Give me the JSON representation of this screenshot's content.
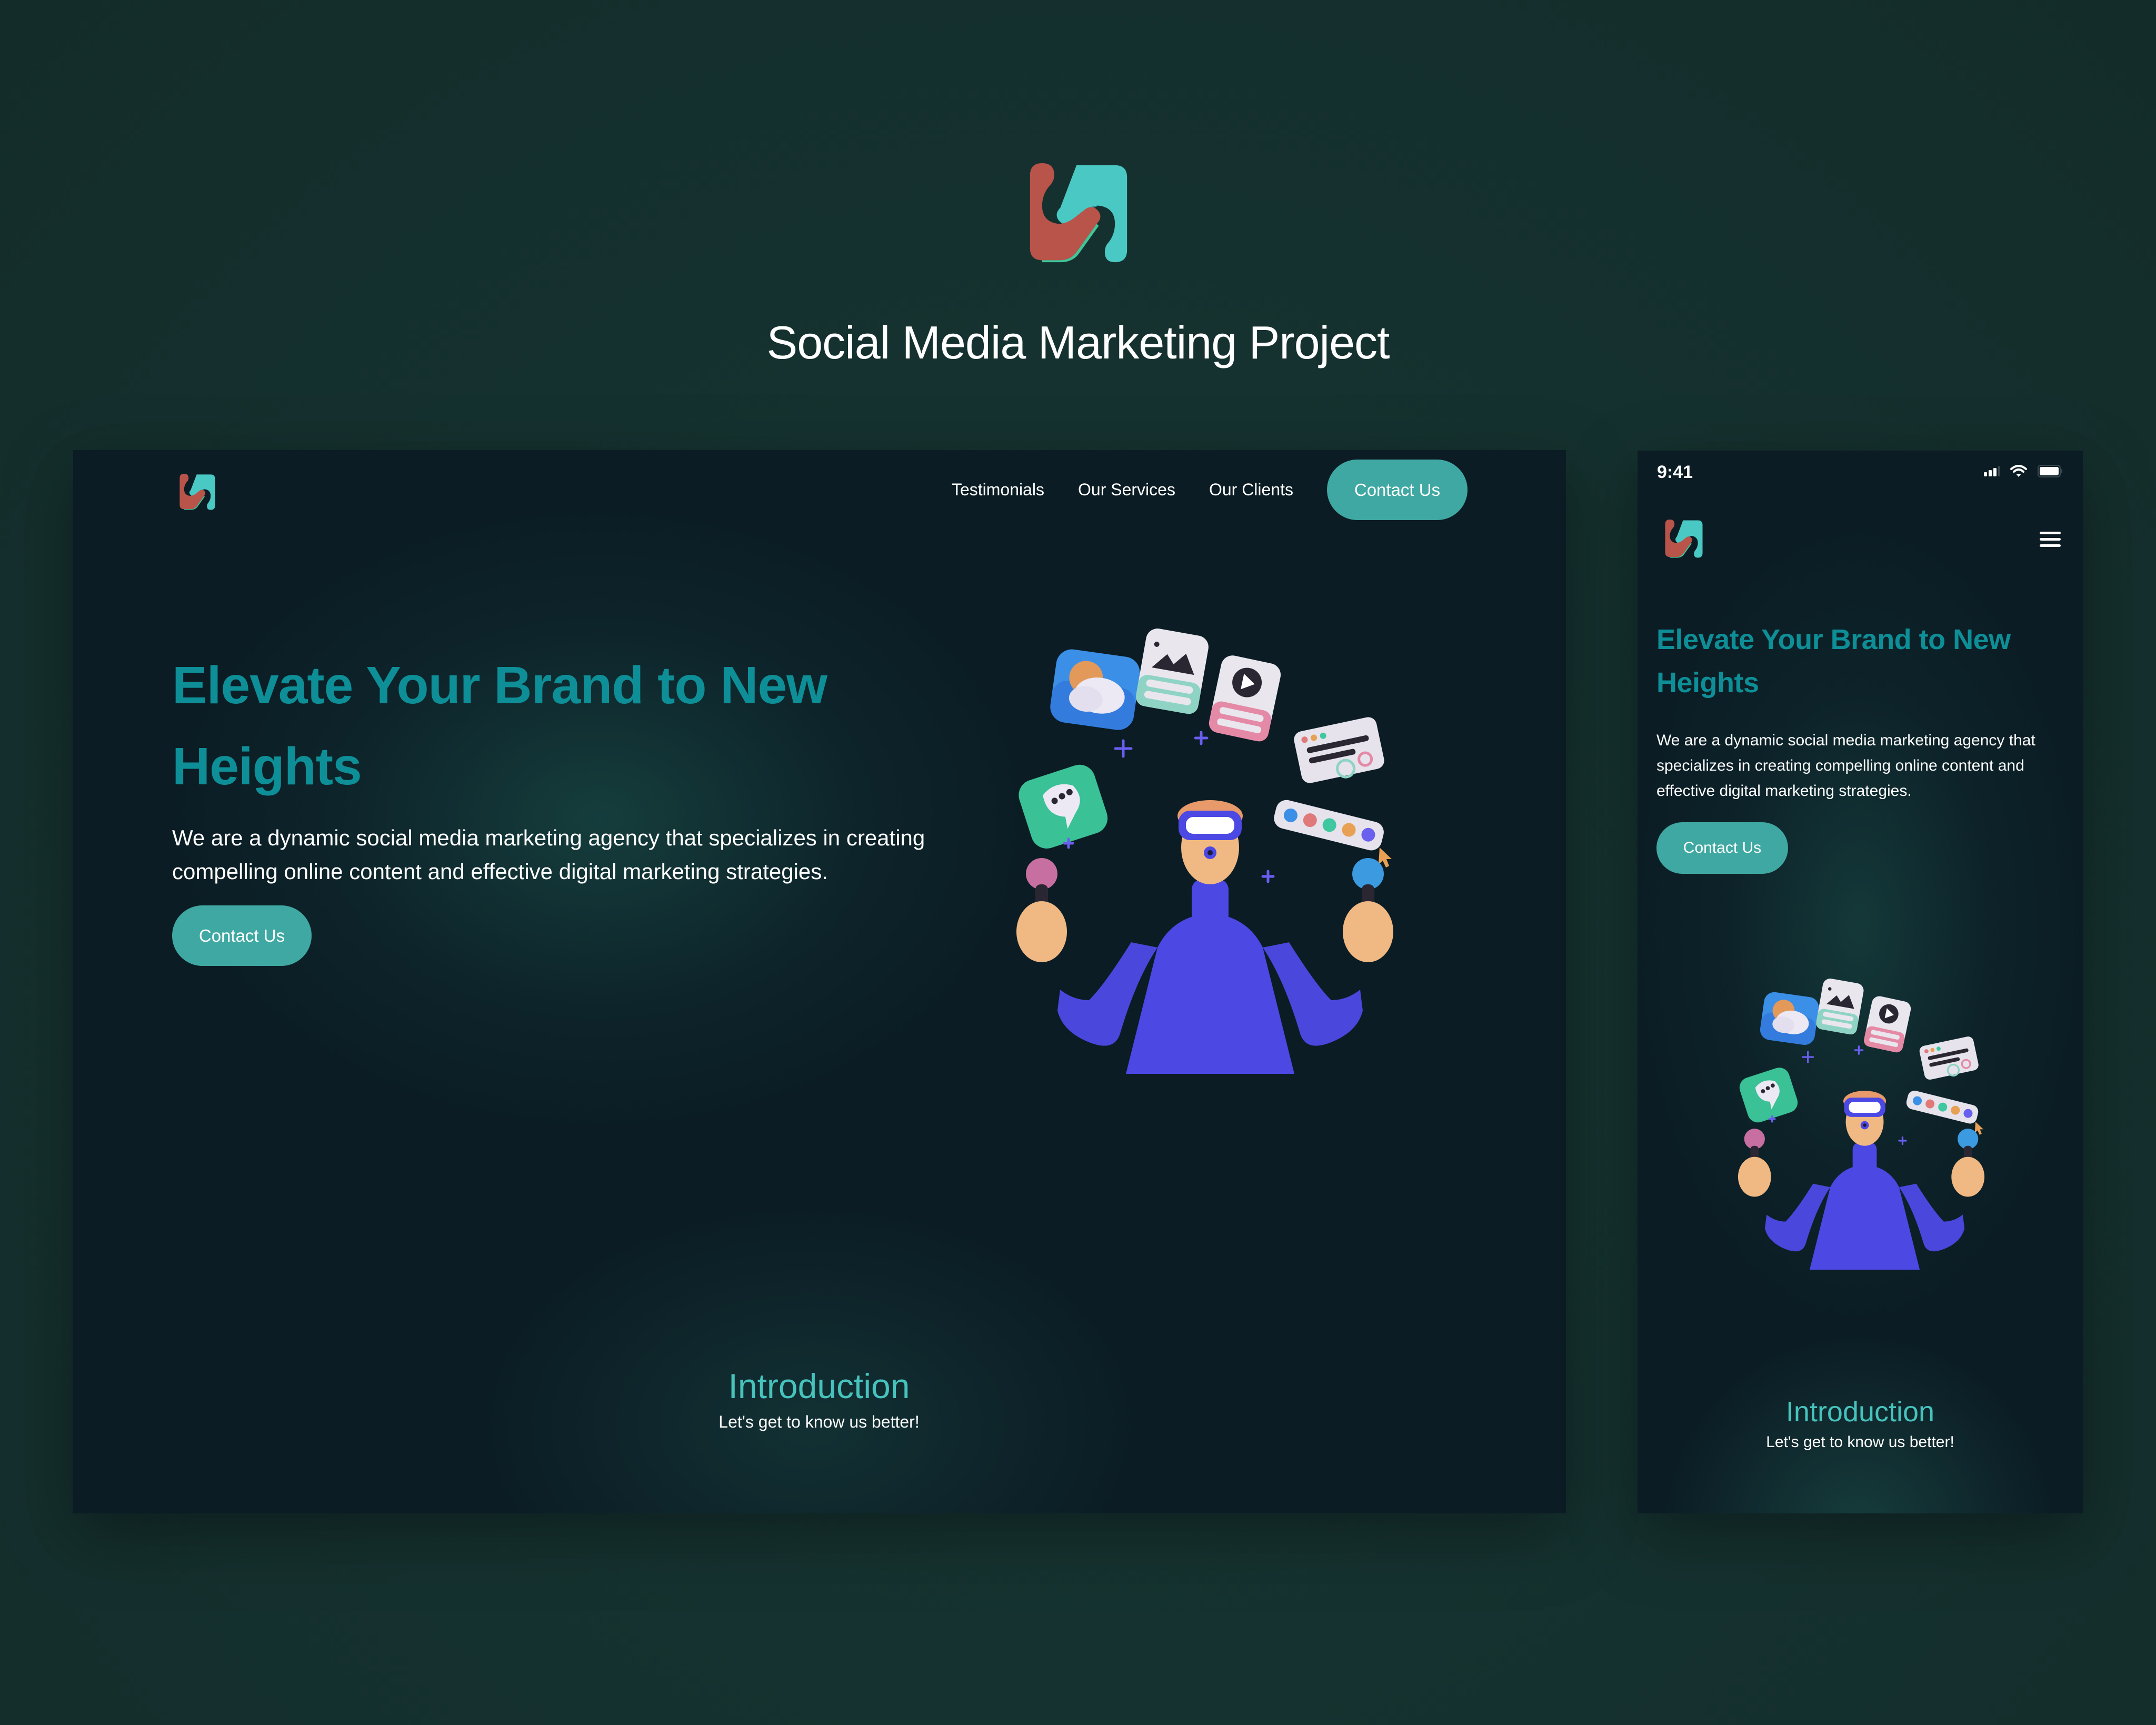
{
  "showcase": {
    "logo_icon": "brand-logo-icon",
    "title": "Social Media Marketing Project",
    "background": "#15312f"
  },
  "colors": {
    "accent": "#3fa8a2",
    "heading": "#0e8f97",
    "intro_heading": "#46c3bd",
    "logo_red": "#b9544a",
    "logo_teal": "#4ac8c3",
    "frame_background": "#0b1c24"
  },
  "desktop": {
    "logo_icon": "brand-logo-icon",
    "nav": {
      "items": [
        "Testimonials",
        "Our Services",
        "Our Clients"
      ],
      "cta": "Contact Us"
    },
    "hero": {
      "title": "Elevate Your Brand to New Heights",
      "description": "We are a dynamic social media marketing agency that specializes in creating compelling online content and effective digital marketing strategies.",
      "cta": "Contact Us",
      "illustration": "vr-person-juggling-social-icons-illustration"
    },
    "intro": {
      "title": "Introduction",
      "subtitle": "Let's get to know us better!"
    }
  },
  "mobile": {
    "status_bar": {
      "time": "9:41",
      "icons": [
        "signal-icon",
        "wifi-icon",
        "battery-icon"
      ]
    },
    "logo_icon": "brand-logo-icon",
    "menu_icon": "hamburger-menu-icon",
    "hero": {
      "title": "Elevate Your Brand to New Heights",
      "description": "We are a dynamic social media marketing agency that specializes in creating compelling online content and effective digital marketing strategies.",
      "cta": "Contact Us",
      "illustration": "vr-person-juggling-social-icons-illustration"
    },
    "intro": {
      "title": "Introduction",
      "subtitle": "Let's get to know us better!"
    }
  }
}
